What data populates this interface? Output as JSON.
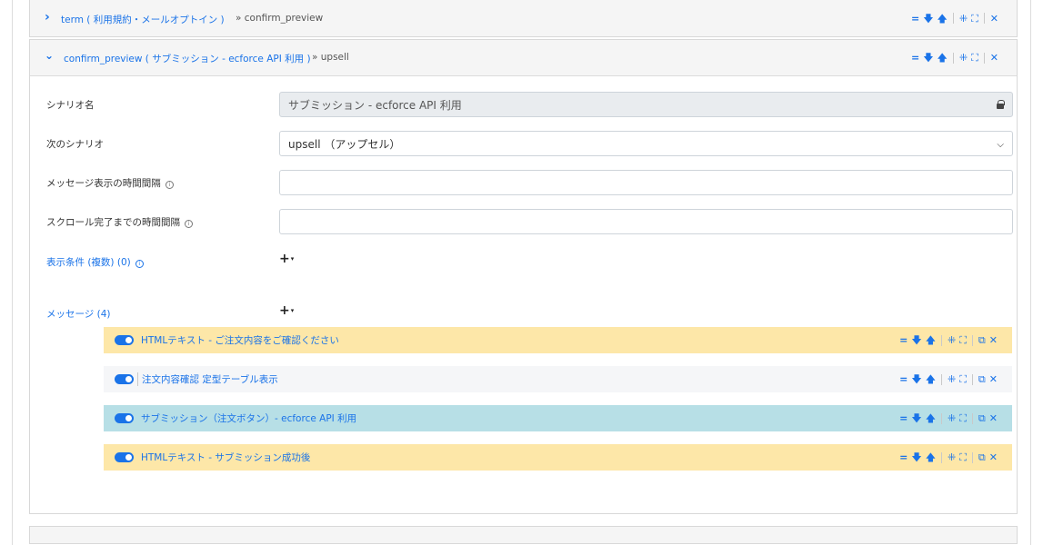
{
  "panels": [
    {
      "title": "term ( 利用規約・メールオプトイン )",
      "next": "» confirm_preview",
      "chevron": "›"
    },
    {
      "title": "confirm_preview ( サブミッション - ecforce API 利用 )",
      "next": "» upsell",
      "chevron": "⌄"
    }
  ],
  "form": {
    "scenario_name_label": "シナリオ名",
    "scenario_name_value": "サブミッション - ecforce API 利用",
    "next_scenario_label": "次のシナリオ",
    "next_scenario_value": "upsell （アップセル）",
    "message_interval_label": "メッセージ表示の時間間隔",
    "scroll_interval_label": "スクロール完了までの時間間隔",
    "conditions_label": "表示条件 (複数) (0)",
    "messages_label": "メッセージ (4)"
  },
  "messages": [
    {
      "label": "HTMLテキスト - ご注文内容をご確認ください",
      "bg": "#fde7a8"
    },
    {
      "label": "注文内容確認 定型テーブル表示",
      "bg": "#f5f6f8"
    },
    {
      "label": "サブミッション（注文ボタン）- ecforce API 利用",
      "bg": "#b7dfe6"
    },
    {
      "label": "HTMLテキスト - サブミッション成功後",
      "bg": "#fde7a8"
    }
  ],
  "icons": {
    "equals": "=",
    "down": "🡇",
    "up": "🡅",
    "collapse": "⁜",
    "expand": "⛶",
    "copy": "⧉",
    "close": "✕",
    "info": "i",
    "plus": "+",
    "caret": "▾"
  },
  "colors": {
    "accent": "#1a73e8"
  }
}
